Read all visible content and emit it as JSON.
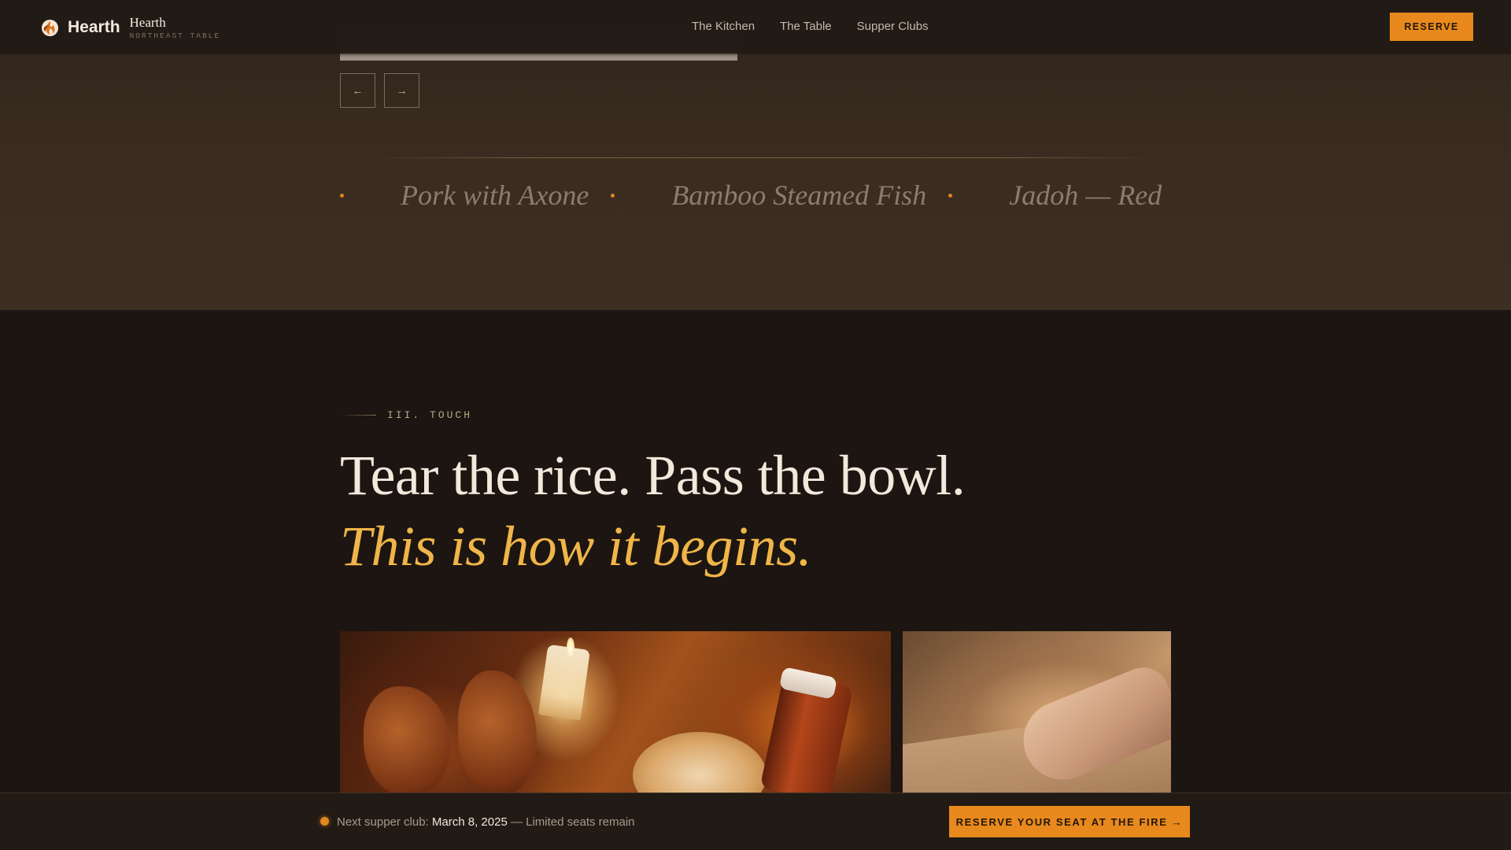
{
  "header": {
    "brand_name": "Hearth",
    "brand_sub_title": "Hearth",
    "brand_tagline": "NORTHEAST TABLE",
    "nav": [
      "The Kitchen",
      "The Table",
      "Supper Clubs"
    ],
    "reserve_label": "RESERVE",
    "logo_icon": "flame-logo-icon"
  },
  "carousel": {
    "prev_icon": "arrow-left-icon",
    "next_icon": "arrow-right-icon",
    "prev_glyph": "←",
    "next_glyph": "→"
  },
  "dishes": [
    "Pork with Axone",
    "Bamboo Steamed Fish",
    "Jadoh — Red"
  ],
  "section": {
    "label": "III. TOUCH",
    "headline": "Tear the rice. Pass the bowl.",
    "subhead": "This is how it begins."
  },
  "bottom_bar": {
    "prefix": "Next supper club:",
    "date": "March 8, 2025",
    "suffix": "— Limited seats remain",
    "cta_label": "RESERVE YOUR SEAT AT THE FIRE →"
  },
  "colors": {
    "accent": "#e8891d",
    "highlight_text": "#efb548",
    "background": "#1c1511"
  }
}
